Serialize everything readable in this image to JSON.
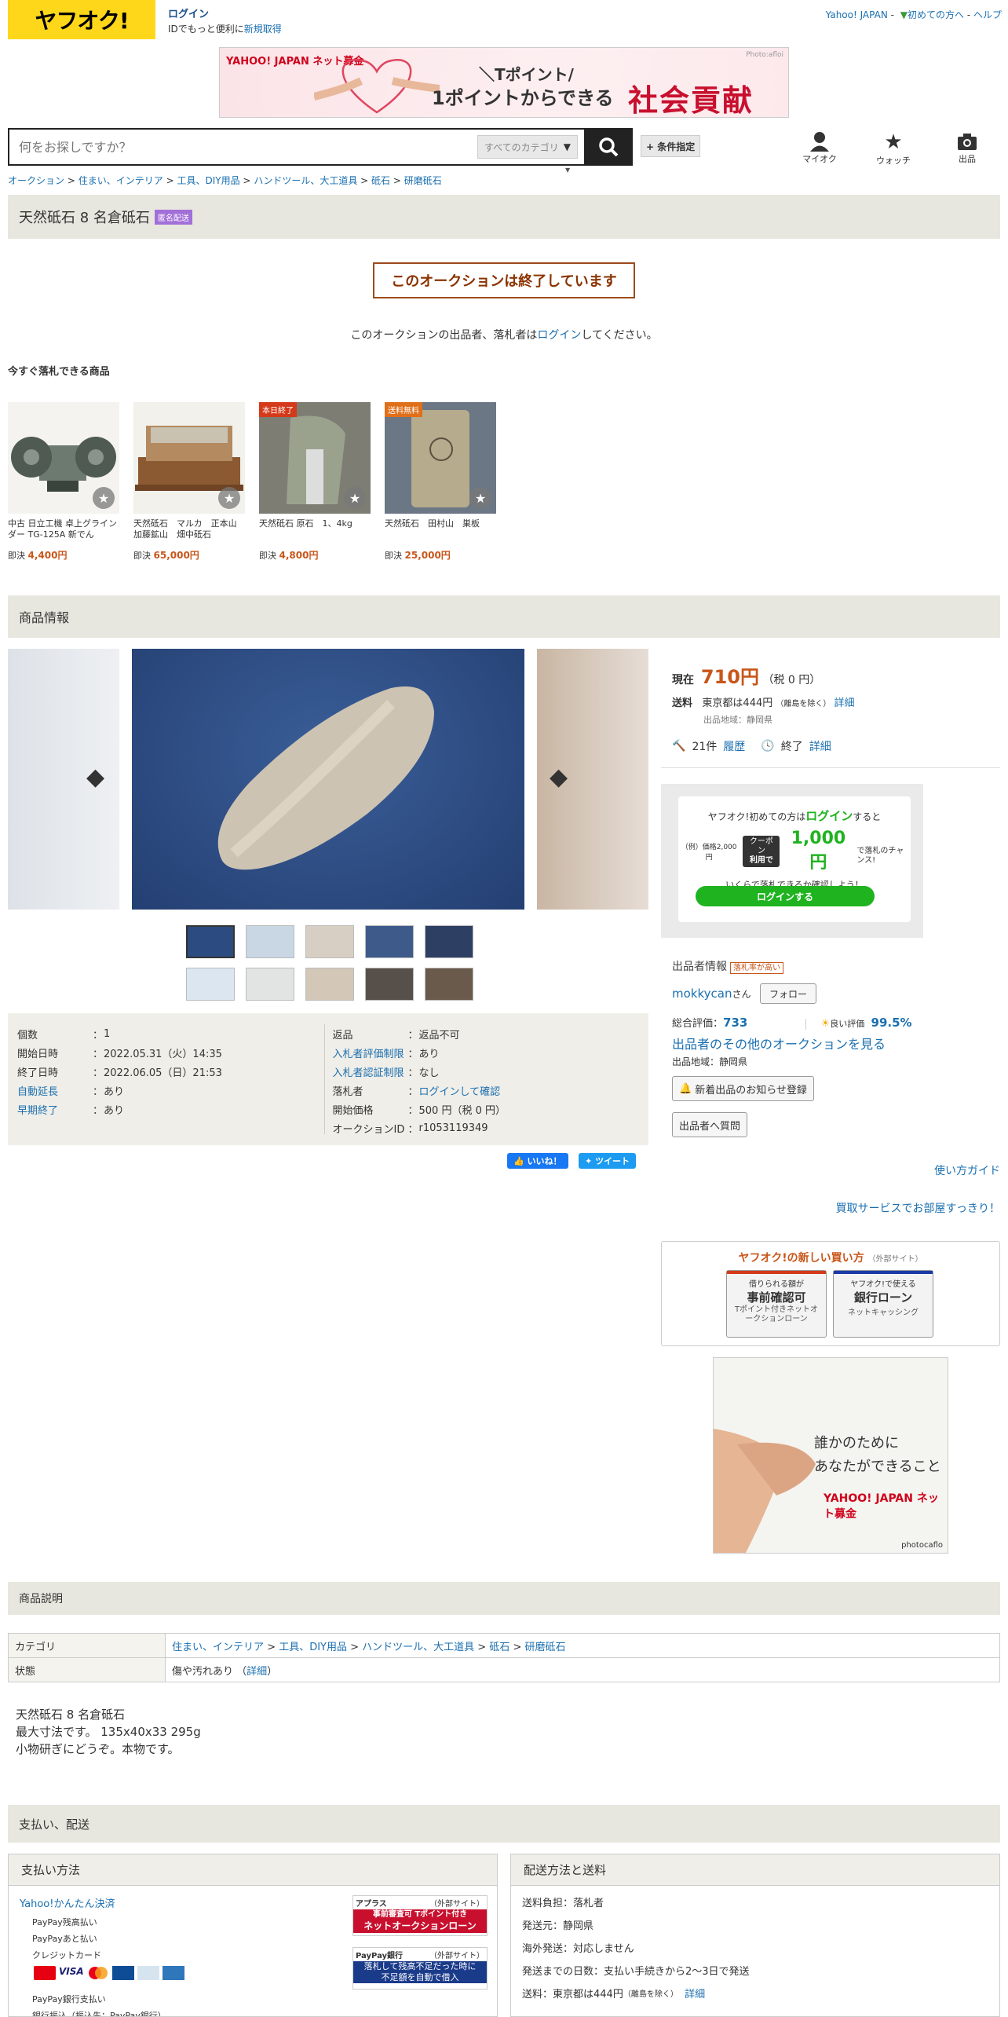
{
  "header": {
    "logo": "ヤフオク!",
    "login": "ログイン",
    "login_sub": "IDでもっと便利に",
    "register": "新規取得",
    "yahoo_japan": "Yahoo! JAPAN",
    "first_time": "初めての方へ",
    "help": "ヘルプ"
  },
  "banner": {
    "logo": "YAHOO! JAPAN ネット募金",
    "line1": "＼Tポイント/",
    "line2": "1ポイントからできる",
    "line3": "社会貢献",
    "credit": "Photo:afloi"
  },
  "search": {
    "placeholder": "何をお探しですか？",
    "category": "すべてのカテゴリ",
    "conditions": "+ 条件指定"
  },
  "nav_icons": [
    {
      "label": "マイオク",
      "icon": "person-icon"
    },
    {
      "label": "ウォッチ",
      "icon": "star-icon"
    },
    {
      "label": "出品",
      "icon": "camera-icon"
    }
  ],
  "breadcrumb": [
    "オークション",
    "住まい、インテリア",
    "工具、DIY用品",
    "ハンドツール、大工道具",
    "砥石",
    "研磨砥石"
  ],
  "title": "天然砥石 8 名倉砥石",
  "title_badge": "匿名配送",
  "ended": "このオークションは終了しています",
  "ended_note_pre": "このオークションの出品者、落札者は",
  "ended_note_link": "ログイン",
  "ended_note_post": "してください。",
  "recommend_heading": "今すぐ落札できる商品",
  "recommend": [
    {
      "name": "中古 日立工機 卓上グラインダー TG-125A 新でん",
      "buy_label": "即決",
      "price": "4,400円",
      "tag": ""
    },
    {
      "name": "天然砥石　マルカ　正本山　加藤鉱山　畑中砥石",
      "buy_label": "即決",
      "price": "65,000円",
      "tag": ""
    },
    {
      "name": "天然砥石 原石　1、4kg",
      "buy_label": "即決",
      "price": "4,800円",
      "tag": "本日終了"
    },
    {
      "name": "天然砥石　田村山　巣板",
      "buy_label": "即決",
      "price": "25,000円",
      "tag": "送料無料"
    }
  ],
  "info_heading": "商品情報",
  "details_left": [
    {
      "k": "個数",
      "v": "1",
      "link": false
    },
    {
      "k": "開始日時",
      "v": "2022.05.31（火）14:35",
      "link": false
    },
    {
      "k": "終了日時",
      "v": "2022.06.05（日）21:53",
      "link": false
    },
    {
      "k": "自動延長",
      "v": "あり",
      "link": true
    },
    {
      "k": "早期終了",
      "v": "あり",
      "link": true
    }
  ],
  "details_right": [
    {
      "k": "返品",
      "v": "返品不可",
      "klink": false,
      "vlink": false
    },
    {
      "k": "入札者評価制限",
      "v": "あり",
      "klink": true,
      "vlink": false
    },
    {
      "k": "入札者認証制限",
      "v": "なし",
      "klink": true,
      "vlink": false
    },
    {
      "k": "落札者",
      "v": "ログインして確認",
      "klink": false,
      "vlink": true
    },
    {
      "k": "開始価格",
      "v": "500 円（税 0 円）",
      "klink": false,
      "vlink": false
    },
    {
      "k": "オークションID",
      "v": "r1053119349",
      "klink": false,
      "vlink": false
    }
  ],
  "social": {
    "like": "いいね！",
    "tweet": "ツイート"
  },
  "price": {
    "label": "現在",
    "value": "710円",
    "tax": "（税 0 円）",
    "shipping_label": "送料",
    "shipping_value": "東京都は444円",
    "shipping_note": "（離島を除く）",
    "detail_link": "詳細",
    "origin": "出品地域：静岡県",
    "bids": "21件",
    "history": "履歴",
    "status": "終了",
    "status_detail": "詳細"
  },
  "promo": {
    "line1_pre": "ヤフオク!初めての方は",
    "line1_link": "ログイン",
    "line1_post": "すると",
    "example": "（例）価格2,000円",
    "coupon": "クーポン",
    "coupon_use": "利用で",
    "amount": "1,000円",
    "chance": "で落札のチャンス!",
    "check": "いくらで落札できるか確認しよう！",
    "button": "ログインする"
  },
  "seller": {
    "heading": "出品者情報",
    "tag": "落札率が高い",
    "name": "mokkycan",
    "suffix": "さん",
    "follow": "フォロー",
    "total_label": "総合評価：",
    "total": "733",
    "good_label": "良い評価",
    "good": "99.5%",
    "others": "出品者のその他のオークションを見る",
    "region": "出品地域：静岡県",
    "notify": "新着出品のお知らせ登録",
    "question": "出品者へ質問"
  },
  "guide": "使い方ガイド",
  "kaitori": "買取サービスでお部屋すっきり！",
  "newway": {
    "heading": "ヤフオク!の新しい買い方",
    "external": "（外部サイト）",
    "card1_top": "借りられる額が",
    "card1_main": "事前確認可",
    "card1_sub": "Tポイント付きネットオークションローン",
    "card2_top": "ヤフオク!で使える",
    "card2_main": "銀行ローン",
    "card2_sub": "ネットキャッシング"
  },
  "ad2": {
    "line1": "誰かのために",
    "line2": "あなたができること",
    "logo": "YAHOO! JAPAN ネット募金",
    "credit": "photocaflo"
  },
  "desc_heading": "商品説明",
  "category_row": {
    "k": "カテゴリ",
    "path": [
      "住まい、インテリア",
      "工具、DIY用品",
      "ハンドツール、大工道具",
      "砥石",
      "研磨砥石"
    ]
  },
  "condition_row": {
    "k": "状態",
    "v": "傷や汚れあり",
    "detail": "詳細"
  },
  "description": [
    "天然砥石 8 名倉砥石",
    "最大寸法です。 135x40x33  295g",
    "小物研ぎにどうぞ。本物です。"
  ],
  "pay_heading": "支払い、配送",
  "payment": {
    "heading": "支払い方法",
    "easy": "Yahoo!かんたん決済",
    "items": [
      "PayPay残高払い",
      "PayPayあと払い",
      "クレジットカード"
    ],
    "bank": "PayPay銀行支払い",
    "bank2": "銀行振込（振込先：PayPay銀行）",
    "ad1_label": "アプラス",
    "ad1_ext": "（外部サイト）",
    "ad1_sub": "事前審査可",
    "ad1_tp": "Tポイント付き",
    "ad1_main": "ネットオークションローン",
    "ad2_label": "PayPay銀行",
    "ad2_ext": "（外部サイト）",
    "ad2_main": "落札して残高不足だった時に",
    "ad2_sub": "不足額を自動で借入"
  },
  "shipping": {
    "heading": "配送方法と送料",
    "lines": [
      "送料負担：落札者",
      "発送元：静岡県",
      "海外発送：対応しません",
      "発送までの日数：支払い手続きから2〜3日で発送"
    ],
    "fee_pre": "送料：東京都は444円",
    "fee_note": "（離島を除く）",
    "fee_link": "詳細"
  }
}
